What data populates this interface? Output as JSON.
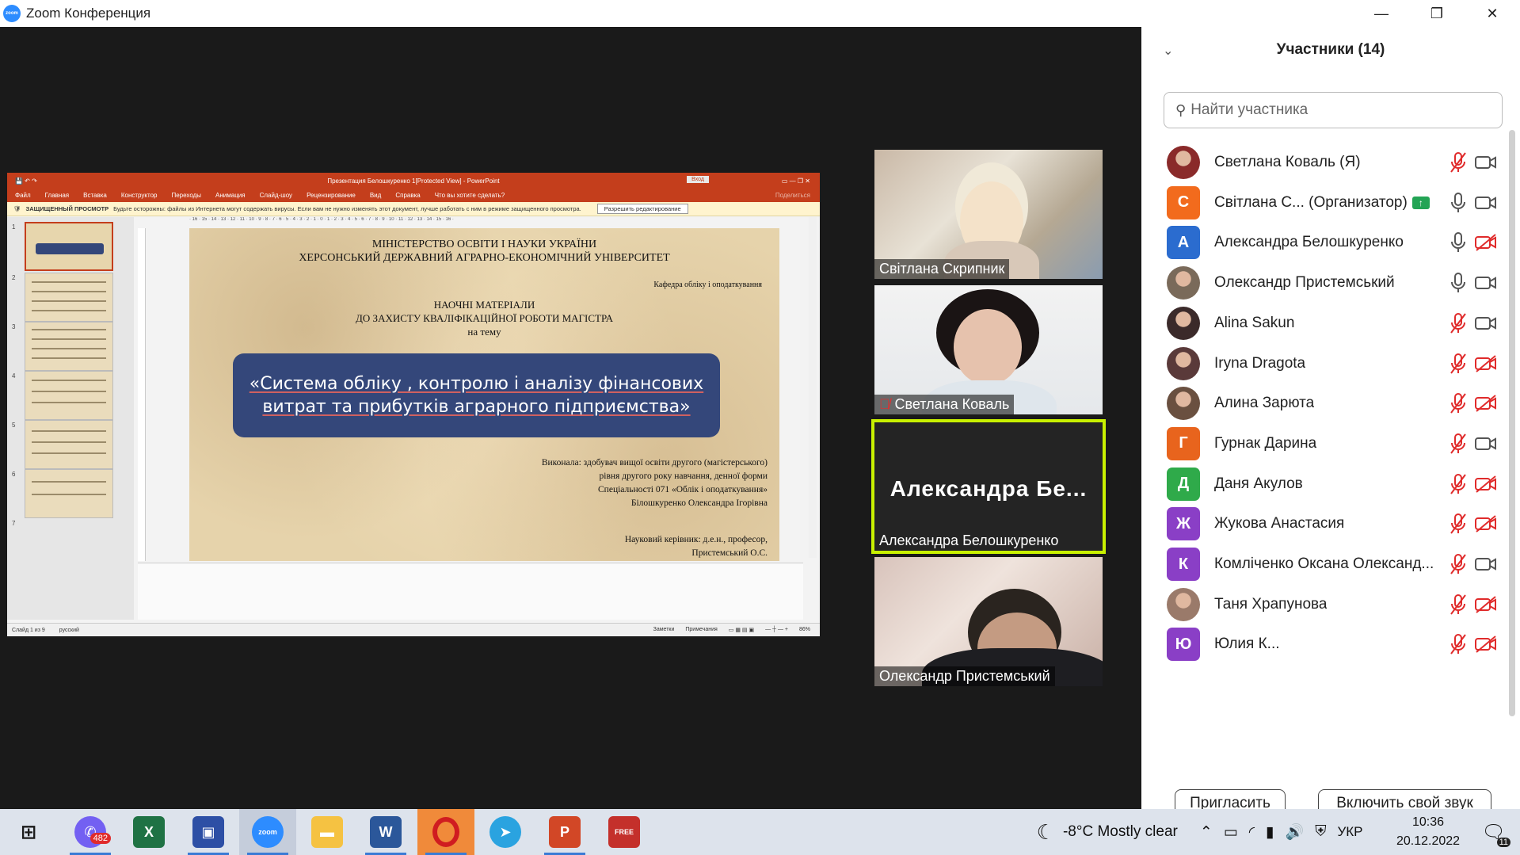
{
  "window": {
    "title": "Zoom Конференция",
    "app_logo": "zoom"
  },
  "ppt": {
    "title": "Презентация Белошкуренко 1[Protected View] - PowerPoint",
    "signin": "Вход",
    "share_label": "Поделиться",
    "menu": [
      "Файл",
      "Главная",
      "Вставка",
      "Конструктор",
      "Переходы",
      "Анимация",
      "Слайд-шоу",
      "Рецензирование",
      "Вид",
      "Справка",
      "Что вы хотите сделать?"
    ],
    "protected_title": "ЗАЩИЩЕННЫЙ ПРОСМОТР",
    "protected_text": "Будьте осторожны: файлы из Интернета могут содержать вирусы. Если вам не нужно изменять этот документ, лучше работать с ним в режиме защищенного просмотра.",
    "enable_edit": "Разрешить редактирование",
    "ruler": "· 16 · 15 · 14 · 13 · 12 · 11 · 10 · 9 · 8 · 7 · 6 · 5 · 4 · 3 · 2 · 1 · 0 · 1 · 2 · 3 · 4 · 5 · 6 · 7 · 8 · 9 · 10 · 11 · 12 · 13 · 14 · 15 · 16 ·",
    "thumb_numbers": [
      "1",
      "2",
      "3",
      "4",
      "5",
      "6",
      "7"
    ],
    "slide": {
      "ministry": "МІНІСТЕРСТВО ОСВІТИ І НАУКИ УКРАЇНИ",
      "university": "ХЕРСОНСЬКИЙ ДЕРЖАВНИЙ АГРАРНО-ЕКОНОМІЧНИЙ УНІВЕРСИТЕТ",
      "department": "Кафедра обліку і оподаткування",
      "materials1": "НАОЧНІ МАТЕРІАЛИ",
      "materials2": "ДО ЗАХИСТУ КВАЛІФІКАЦІЙНОЇ РОБОТИ МАГІСТРА",
      "materials3": "на тему",
      "topic": "«Система обліку , контролю і аналізу фінансових витрат та прибутків аграрного підприємства»",
      "author_lines": [
        "Виконала: здобувач вищої освіти другого (магістерського)",
        "рівня другого року навчання, денної форми",
        "Спеціальності 071 «Облік і оподаткування»",
        "Білошкуренко Олександра Ігорівна"
      ],
      "supervisor_lines": [
        "Науковий керівник: д.е.н., професор,",
        "Пристемський О.С."
      ]
    },
    "status": {
      "slide": "Слайд 1 из 9",
      "lang": "русский",
      "notes": "Заметки",
      "comments": "Примечания",
      "zoom": "86%"
    }
  },
  "videos": [
    {
      "name": "Світлана Скрипник",
      "muted": false
    },
    {
      "name": "Светлана Коваль",
      "muted": true
    },
    {
      "name": "Александра Белошкуренко",
      "big": "Александра  Бе...",
      "muted": false,
      "active": true
    },
    {
      "name": "Олександр Пристемський",
      "muted": false
    }
  ],
  "panel": {
    "title": "Участники (14)",
    "search_placeholder": "Найти участника",
    "invite": "Пригласить",
    "unmute": "Включить свой звук",
    "participants": [
      {
        "name": "Светлана Коваль (Я)",
        "avatar": "photo",
        "color": "#8a2a2a",
        "mic": "off",
        "video": "on"
      },
      {
        "name": "Світлана С...  (Организатор)",
        "avatar": "С",
        "color": "#f26b1d",
        "mic": "on",
        "video": "on",
        "sharing": true
      },
      {
        "name": "Александра Белошкуренко",
        "avatar": "А",
        "color": "#2b6ccf",
        "mic": "on",
        "video": "off"
      },
      {
        "name": "Олександр Пристемський",
        "avatar": "photo",
        "color": "#7a6a5a",
        "mic": "on",
        "video": "on"
      },
      {
        "name": "Alina Sakun",
        "avatar": "photo",
        "color": "#3b2a2a",
        "mic": "off",
        "video": "on"
      },
      {
        "name": "Iryna Dragota",
        "avatar": "photo",
        "color": "#5a3a3a",
        "mic": "off",
        "video": "off"
      },
      {
        "name": "Алина Зарюта",
        "avatar": "photo",
        "color": "#6a5040",
        "mic": "off",
        "video": "off"
      },
      {
        "name": "Гурнак Дарина",
        "avatar": "Г",
        "color": "#e8641d",
        "mic": "off",
        "video": "on"
      },
      {
        "name": "Даня Акулов",
        "avatar": "Д",
        "color": "#2faa4a",
        "mic": "off",
        "video": "off"
      },
      {
        "name": "Жукова Анастасия",
        "avatar": "Ж",
        "color": "#8a3fc6",
        "mic": "off",
        "video": "off"
      },
      {
        "name": "Комліченко Оксана Олександ...",
        "avatar": "К",
        "color": "#8a3fc6",
        "mic": "off",
        "video": "on"
      },
      {
        "name": "Таня Храпунова",
        "avatar": "photo",
        "color": "#9a7a6a",
        "mic": "off",
        "video": "off"
      },
      {
        "name": "Юлия К...",
        "avatar": "Ю",
        "color": "#8a3fc6",
        "mic": "off",
        "video": "off"
      }
    ]
  },
  "taskbar": {
    "apps": [
      "start",
      "viber",
      "excel",
      "save",
      "zoom",
      "explorer",
      "word",
      "opera",
      "telegram",
      "powerpoint",
      "anyvideo"
    ],
    "viber_badge": "482",
    "weather": "-8°C  Mostly clear",
    "lang": "УКР",
    "time": "10:36",
    "date": "20.12.2022",
    "notifications": "11"
  }
}
